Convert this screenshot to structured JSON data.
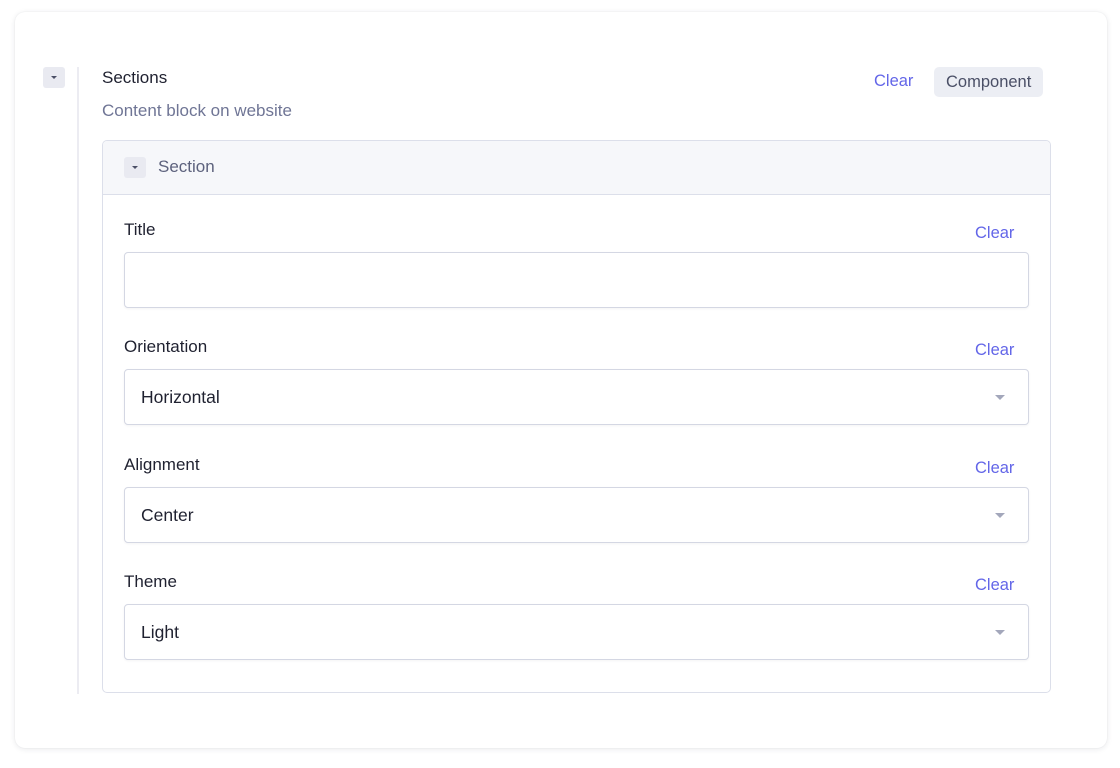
{
  "sections": {
    "title": "Sections",
    "description": "Content block on website",
    "clear_label": "Clear",
    "component_tag": "Component"
  },
  "section": {
    "header_label": "Section",
    "fields": {
      "title": {
        "label": "Title",
        "clear_label": "Clear",
        "value": ""
      },
      "orientation": {
        "label": "Orientation",
        "clear_label": "Clear",
        "value": "Horizontal"
      },
      "alignment": {
        "label": "Alignment",
        "clear_label": "Clear",
        "value": "Center"
      },
      "theme": {
        "label": "Theme",
        "clear_label": "Clear",
        "value": "Light"
      }
    }
  },
  "icons": {
    "collapse": "chevron-down-icon",
    "select_caret": "caret-down-icon"
  },
  "colors": {
    "accent": "#6366e8",
    "muted_text": "#6f7595",
    "border": "#dcdfea"
  }
}
